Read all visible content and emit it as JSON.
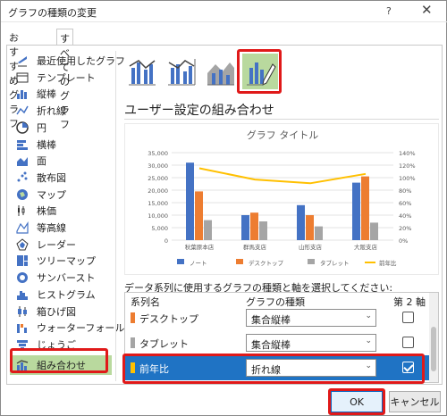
{
  "window": {
    "title": "グラフの種類の変更",
    "help": "?",
    "close": "✕"
  },
  "tabs": [
    "おすすめグラフ",
    "すべてのグラフ"
  ],
  "sidebar": {
    "items": [
      {
        "label": "最近使用したグラフ",
        "icon": "recent-icon"
      },
      {
        "label": "テンプレート",
        "icon": "template-icon"
      },
      {
        "label": "縦棒",
        "icon": "column-chart-icon"
      },
      {
        "label": "折れ線",
        "icon": "line-chart-icon"
      },
      {
        "label": "円",
        "icon": "pie-chart-icon"
      },
      {
        "label": "横棒",
        "icon": "bar-chart-icon"
      },
      {
        "label": "面",
        "icon": "area-chart-icon"
      },
      {
        "label": "散布図",
        "icon": "scatter-chart-icon"
      },
      {
        "label": "マップ",
        "icon": "map-chart-icon"
      },
      {
        "label": "株価",
        "icon": "stock-chart-icon"
      },
      {
        "label": "等高線",
        "icon": "surface-chart-icon"
      },
      {
        "label": "レーダー",
        "icon": "radar-chart-icon"
      },
      {
        "label": "ツリーマップ",
        "icon": "treemap-icon"
      },
      {
        "label": "サンバースト",
        "icon": "sunburst-icon"
      },
      {
        "label": "ヒストグラム",
        "icon": "histogram-icon"
      },
      {
        "label": "箱ひげ図",
        "icon": "box-whisker-icon"
      },
      {
        "label": "ウォーターフォール",
        "icon": "waterfall-icon"
      },
      {
        "label": "じょうご",
        "icon": "funnel-icon"
      },
      {
        "label": "組み合わせ",
        "icon": "combo-chart-icon"
      }
    ],
    "selected": "組み合わせ"
  },
  "subtypes": [
    "clustered-column-line-icon",
    "clustered-column-line-secondary-icon",
    "stacked-area-column-icon",
    "custom-combination-icon"
  ],
  "heading": "ユーザー設定の組み合わせ",
  "chart_data": {
    "type": "bar",
    "title": "グラフ タイトル",
    "categories": [
      "秋葉原本店",
      "群馬支店",
      "山形支店",
      "大阪支店"
    ],
    "series": [
      {
        "name": "ノート",
        "type": "bar",
        "axis": "primary",
        "values": [
          31000,
          10000,
          14000,
          23000
        ]
      },
      {
        "name": "デスクトップ",
        "type": "bar",
        "axis": "primary",
        "values": [
          19500,
          11000,
          10000,
          25500
        ]
      },
      {
        "name": "タブレット",
        "type": "bar",
        "axis": "primary",
        "values": [
          8000,
          7500,
          5500,
          7000
        ]
      },
      {
        "name": "前年比",
        "type": "line",
        "axis": "secondary",
        "values": [
          1.15,
          0.97,
          0.91,
          1.06
        ]
      }
    ],
    "ylim": [
      0,
      35000
    ],
    "yticks": [
      "35,000",
      "30,000",
      "25,000",
      "20,000",
      "15,000",
      "10,000",
      "5,000",
      "0"
    ],
    "y2lim": [
      0,
      1.4
    ],
    "y2ticks": [
      "140%",
      "120%",
      "100%",
      "80%",
      "60%",
      "40%",
      "20%",
      "0%"
    ],
    "colors": {
      "ノート": "#4472c4",
      "デスクトップ": "#ed7d31",
      "タブレット": "#a5a5a5",
      "前年比": "#ffc000"
    },
    "legend": "bottom"
  },
  "instruction": "データ系列に使用するグラフの種類と軸を選択してください:",
  "table": {
    "headers": {
      "name": "系列名",
      "type": "グラフの種類",
      "axis": "第 2 軸"
    },
    "rows": [
      {
        "name": "デスクトップ",
        "type": "集合縦棒",
        "secondary": false,
        "color": "#ed7d31"
      },
      {
        "name": "タブレット",
        "type": "集合縦棒",
        "secondary": false,
        "color": "#a5a5a5"
      },
      {
        "name": "前年比",
        "type": "折れ線",
        "secondary": true,
        "color": "#ffc000"
      }
    ]
  },
  "buttons": {
    "ok": "OK",
    "cancel": "キャンセル"
  },
  "highlight_color": "#e01919"
}
